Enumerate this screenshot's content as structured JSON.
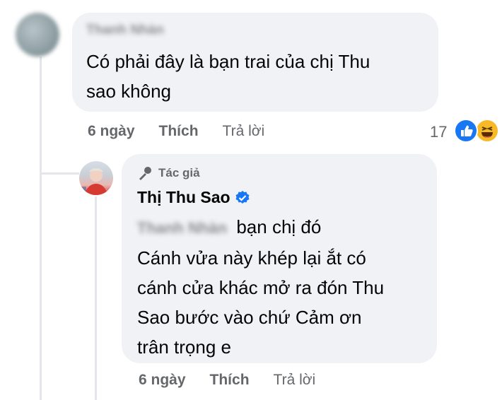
{
  "comment": {
    "author": "Thanh Nhàn",
    "text_line1": "Có phải đây là bạn trai của chị Thu",
    "text_line2": "sao không",
    "time": "6 ngày",
    "like_label": "Thích",
    "reply_label": "Trả lời",
    "reaction_count": "17",
    "reactions": [
      "like-icon",
      "haha-icon"
    ]
  },
  "reply": {
    "badge_label": "Tác giả",
    "author": "Thị Thu Sao",
    "verified": true,
    "mention": "Thanh Nhàn",
    "text_line1_after_mention": "bạn chị đó",
    "text_line2": "Cánh vửa này khép lại ắt có",
    "text_line3": "cánh cửa khác mở ra đón Thu",
    "text_line4": "Sao bước vào chứ Cảm ơn",
    "text_line5": "trân trọng e",
    "time": "6 ngày",
    "like_label": "Thích",
    "reply_label": "Trả lời"
  },
  "colors": {
    "bubble": "#f0f2f5",
    "meta_text": "#65676b",
    "like_blue": "#1877f2",
    "haha_yellow": "#f7b928",
    "thread_line": "#e4e6eb"
  }
}
